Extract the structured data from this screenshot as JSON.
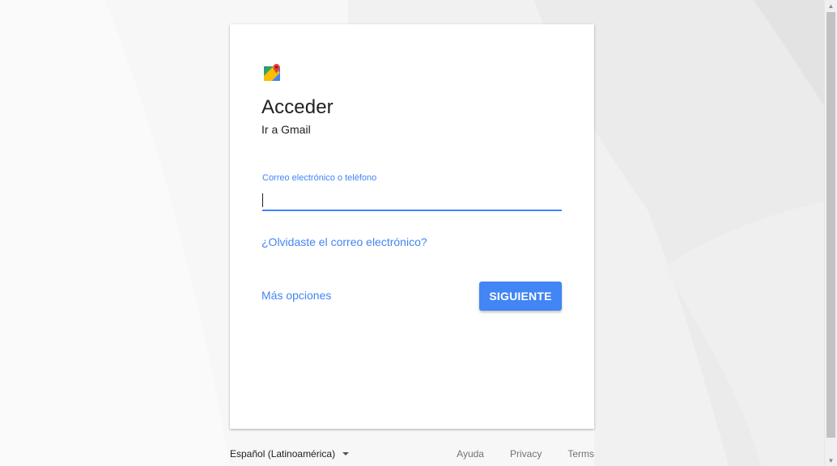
{
  "login": {
    "title": "Acceder",
    "subtitle": "Ir a Gmail",
    "email_label": "Correo electrónico o teléfono",
    "email_value": "",
    "forgot_email_link": "¿Olvidaste el correo electrónico?",
    "more_options_link": "Más opciones",
    "next_button": "SIGUIENTE"
  },
  "footer": {
    "language": "Español (Latinoamérica)",
    "links": [
      "Ayuda",
      "Privacy",
      "Terms"
    ]
  },
  "icons": {
    "logo": "google-maps-icon",
    "language_dropdown": "caret-down-icon"
  },
  "colors": {
    "accent": "#4285f4",
    "text": "#212121",
    "footer_text": "#737373",
    "background": "#f7f7f7",
    "card": "#ffffff"
  }
}
